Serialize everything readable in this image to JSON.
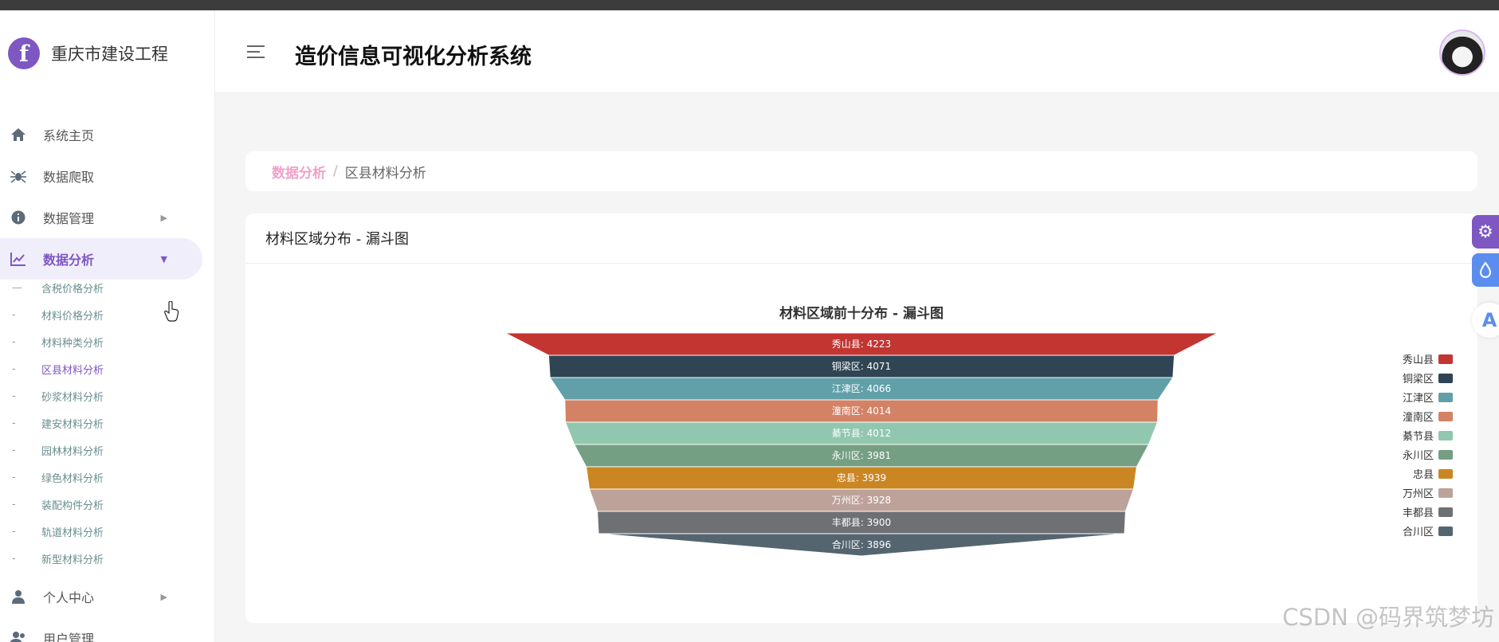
{
  "brand": {
    "name": "重庆市建设工程",
    "logo_letter": "f"
  },
  "header": {
    "title": "造价信息可视化分析系统"
  },
  "menu": [
    {
      "label": "系统主页",
      "icon": "home-icon"
    },
    {
      "label": "数据爬取",
      "icon": "spider-icon"
    },
    {
      "label": "数据管理",
      "icon": "info-icon"
    },
    {
      "label": "数据分析",
      "icon": "chart-line-icon"
    },
    {
      "label": "个人中心",
      "icon": "user-icon"
    },
    {
      "label": "用户管理",
      "icon": "users-icon"
    }
  ],
  "submenu": [
    {
      "dash": "—",
      "label": "含税价格分析"
    },
    {
      "dash": "-",
      "label": "材料价格分析"
    },
    {
      "dash": "-",
      "label": "材料种类分析"
    },
    {
      "dash": "-",
      "label": "区县材料分析"
    },
    {
      "dash": "-",
      "label": "砂浆材料分析"
    },
    {
      "dash": "-",
      "label": "建安材料分析"
    },
    {
      "dash": "-",
      "label": "园林材料分析"
    },
    {
      "dash": "-",
      "label": "绿色材料分析"
    },
    {
      "dash": "-",
      "label": "装配构件分析"
    },
    {
      "dash": "-",
      "label": "轨道材料分析"
    },
    {
      "dash": "-",
      "label": "新型材料分析"
    }
  ],
  "breadcrumb": {
    "parent": "数据分析",
    "separator": "/",
    "current": "区县材料分析"
  },
  "card": {
    "title": "材料区域分布 - 漏斗图"
  },
  "chart_data": {
    "type": "funnel",
    "title": "材料区域前十分布 - 漏斗图",
    "categories": [
      "秀山县",
      "铜梁区",
      "江津区",
      "潼南区",
      "綦节县",
      "永川区",
      "忠县",
      "万州区",
      "丰都县",
      "合川区"
    ],
    "values": [
      4223,
      4071,
      4066,
      4014,
      4012,
      3981,
      3939,
      3928,
      3900,
      3896
    ],
    "colors": [
      "#c23531",
      "#2f4554",
      "#61a0a8",
      "#d48265",
      "#91c7ae",
      "#749f83",
      "#ca8622",
      "#bda29a",
      "#6e7074",
      "#546570"
    ],
    "legend_position": "right"
  },
  "floating_buttons": {
    "settings": "gear-icon",
    "theme": "drop-icon",
    "assistant": "ai-icon"
  },
  "watermark": "CSDN @码界筑梦坊"
}
